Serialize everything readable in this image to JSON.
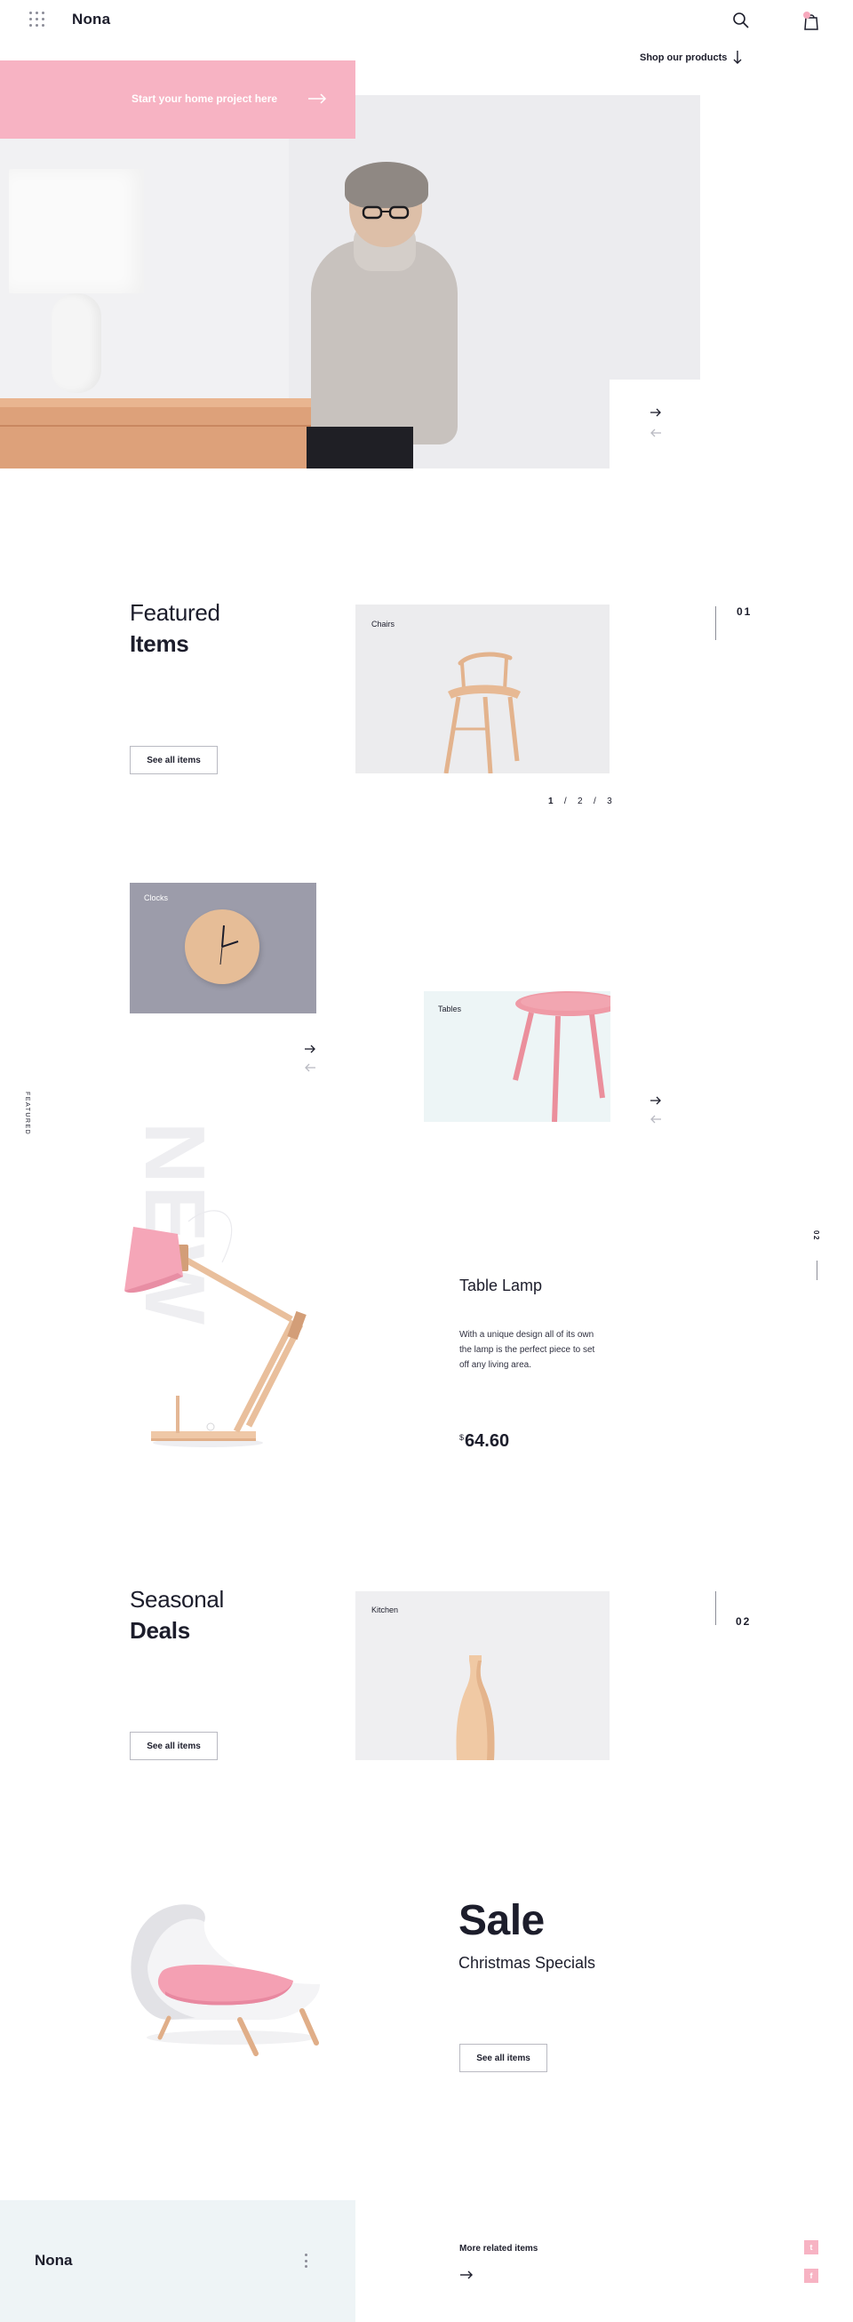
{
  "header": {
    "brand": "Nona",
    "shop_link": "Shop our products",
    "menu_icon": "grid-menu-icon",
    "search_icon": "search-icon",
    "cart_icon": "shopping-bag-icon"
  },
  "hero": {
    "cta_text": "Start your home project here",
    "next_icon": "arrow-right-icon",
    "prev_icon": "arrow-left-icon"
  },
  "featured": {
    "title_light": "Featured",
    "title_bold": "Items",
    "button": "See all items",
    "card_label": "Chairs",
    "section_number": "01",
    "pager": [
      "1",
      "/",
      "2",
      "/",
      "3"
    ],
    "current_page": "1"
  },
  "categories": {
    "clocks_label": "Clocks",
    "tables_label": "Tables"
  },
  "side": {
    "featured_vertical": "FEATURED",
    "right_number": "02"
  },
  "product": {
    "watermark": "NEW",
    "title": "Table Lamp",
    "description": "With a unique design all of its own the lamp is the perfect piece to set off any living area.",
    "currency": "$",
    "price": "64.60"
  },
  "seasonal": {
    "title_light": "Seasonal",
    "title_bold": "Deals",
    "button": "See all items",
    "card_label": "Kitchen",
    "section_number": "02"
  },
  "sale": {
    "title": "Sale",
    "subtitle": "Christmas Specials",
    "button": "See all items"
  },
  "footer": {
    "brand": "Nona",
    "more_related": "More related items",
    "social": [
      {
        "icon": "twitter-icon",
        "glyph": "t"
      },
      {
        "icon": "facebook-icon",
        "glyph": "f"
      }
    ]
  },
  "colors": {
    "accent_pink": "#f7b3c3",
    "dark_text": "#1c1d2b",
    "clock_card": "#9c9caa",
    "tables_card": "#edf5f6",
    "footer_box": "#eef4f6"
  }
}
